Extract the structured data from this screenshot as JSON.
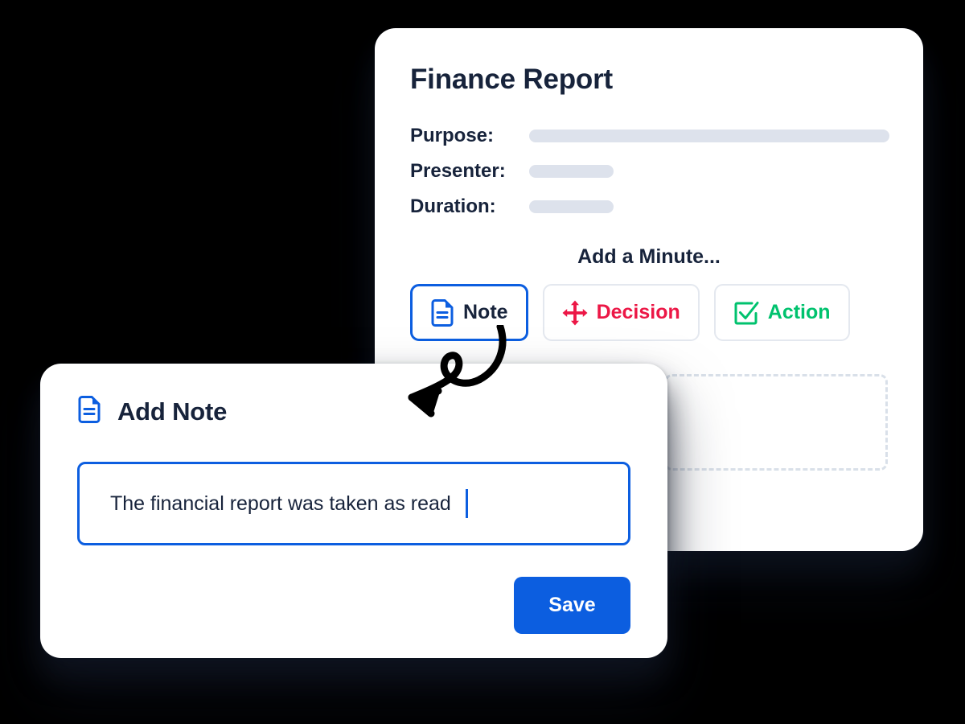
{
  "background_color": "#000000",
  "accent_color": "#0c5ee0",
  "text_color": "#17233b",
  "muted_bar_color": "#dde2ec",
  "report_card": {
    "title": "Finance Report",
    "meta": [
      {
        "label": "Purpose:",
        "value": "",
        "bar": "long"
      },
      {
        "label": "Presenter:",
        "value": "",
        "bar": "short"
      },
      {
        "label": "Duration:",
        "value": "",
        "bar": "short"
      }
    ],
    "add_minute_heading": "Add a Minute...",
    "minute_buttons": [
      {
        "label": "Note",
        "icon": "document-note-icon",
        "color": "#17233b",
        "icon_color": "#0c5ee0",
        "selected": true
      },
      {
        "label": "Decision",
        "icon": "four-way-arrow-icon",
        "color": "#ec1746",
        "icon_color": "#ec1746",
        "selected": false
      },
      {
        "label": "Action",
        "icon": "checkbox-check-icon",
        "color": "#00c26e",
        "icon_color": "#00c26e",
        "selected": false
      }
    ],
    "dropzone": {
      "label": "",
      "border_style": "dashed",
      "border_color": "#d9e0e9"
    }
  },
  "add_note_card": {
    "header_title": "Add Note",
    "header_icon": "document-note-icon",
    "note_input": {
      "value": "The financial report was taken as read",
      "placeholder": "",
      "focused": true,
      "caret_visible": true
    },
    "save_label": "Save"
  },
  "annotation": {
    "arrow": "curved-loop-arrow",
    "points_to": "Note"
  }
}
